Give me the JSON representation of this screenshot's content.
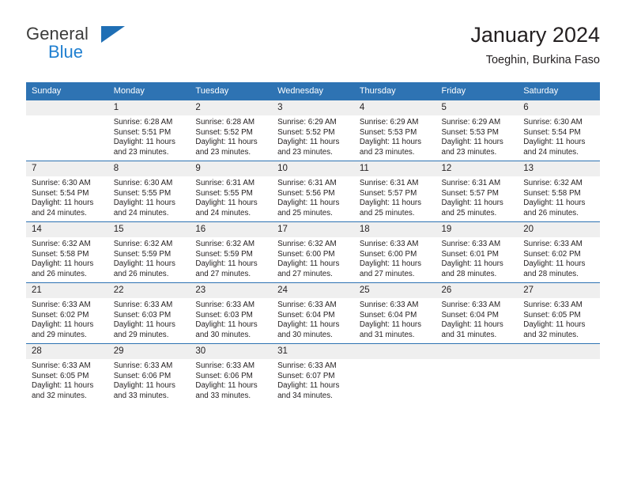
{
  "brand": {
    "name_top": "General",
    "name_bottom": "Blue",
    "triangle_color": "#1f6fb5",
    "blue_color": "#1f7fd0"
  },
  "header": {
    "title": "January 2024",
    "subtitle": "Toeghin, Burkina Faso"
  },
  "theme": {
    "header_blue": "#2e73b3",
    "daynum_gray": "#efefef",
    "text": "#231f20"
  },
  "calendar": {
    "weekday_headers": [
      "Sunday",
      "Monday",
      "Tuesday",
      "Wednesday",
      "Thursday",
      "Friday",
      "Saturday"
    ],
    "weeks": [
      [
        {
          "day": "",
          "sunrise": "",
          "sunset": "",
          "daylight_line1": "",
          "daylight_line2": ""
        },
        {
          "day": "1",
          "sunrise": "Sunrise: 6:28 AM",
          "sunset": "Sunset: 5:51 PM",
          "daylight_line1": "Daylight: 11 hours",
          "daylight_line2": "and 23 minutes."
        },
        {
          "day": "2",
          "sunrise": "Sunrise: 6:28 AM",
          "sunset": "Sunset: 5:52 PM",
          "daylight_line1": "Daylight: 11 hours",
          "daylight_line2": "and 23 minutes."
        },
        {
          "day": "3",
          "sunrise": "Sunrise: 6:29 AM",
          "sunset": "Sunset: 5:52 PM",
          "daylight_line1": "Daylight: 11 hours",
          "daylight_line2": "and 23 minutes."
        },
        {
          "day": "4",
          "sunrise": "Sunrise: 6:29 AM",
          "sunset": "Sunset: 5:53 PM",
          "daylight_line1": "Daylight: 11 hours",
          "daylight_line2": "and 23 minutes."
        },
        {
          "day": "5",
          "sunrise": "Sunrise: 6:29 AM",
          "sunset": "Sunset: 5:53 PM",
          "daylight_line1": "Daylight: 11 hours",
          "daylight_line2": "and 23 minutes."
        },
        {
          "day": "6",
          "sunrise": "Sunrise: 6:30 AM",
          "sunset": "Sunset: 5:54 PM",
          "daylight_line1": "Daylight: 11 hours",
          "daylight_line2": "and 24 minutes."
        }
      ],
      [
        {
          "day": "7",
          "sunrise": "Sunrise: 6:30 AM",
          "sunset": "Sunset: 5:54 PM",
          "daylight_line1": "Daylight: 11 hours",
          "daylight_line2": "and 24 minutes."
        },
        {
          "day": "8",
          "sunrise": "Sunrise: 6:30 AM",
          "sunset": "Sunset: 5:55 PM",
          "daylight_line1": "Daylight: 11 hours",
          "daylight_line2": "and 24 minutes."
        },
        {
          "day": "9",
          "sunrise": "Sunrise: 6:31 AM",
          "sunset": "Sunset: 5:55 PM",
          "daylight_line1": "Daylight: 11 hours",
          "daylight_line2": "and 24 minutes."
        },
        {
          "day": "10",
          "sunrise": "Sunrise: 6:31 AM",
          "sunset": "Sunset: 5:56 PM",
          "daylight_line1": "Daylight: 11 hours",
          "daylight_line2": "and 25 minutes."
        },
        {
          "day": "11",
          "sunrise": "Sunrise: 6:31 AM",
          "sunset": "Sunset: 5:57 PM",
          "daylight_line1": "Daylight: 11 hours",
          "daylight_line2": "and 25 minutes."
        },
        {
          "day": "12",
          "sunrise": "Sunrise: 6:31 AM",
          "sunset": "Sunset: 5:57 PM",
          "daylight_line1": "Daylight: 11 hours",
          "daylight_line2": "and 25 minutes."
        },
        {
          "day": "13",
          "sunrise": "Sunrise: 6:32 AM",
          "sunset": "Sunset: 5:58 PM",
          "daylight_line1": "Daylight: 11 hours",
          "daylight_line2": "and 26 minutes."
        }
      ],
      [
        {
          "day": "14",
          "sunrise": "Sunrise: 6:32 AM",
          "sunset": "Sunset: 5:58 PM",
          "daylight_line1": "Daylight: 11 hours",
          "daylight_line2": "and 26 minutes."
        },
        {
          "day": "15",
          "sunrise": "Sunrise: 6:32 AM",
          "sunset": "Sunset: 5:59 PM",
          "daylight_line1": "Daylight: 11 hours",
          "daylight_line2": "and 26 minutes."
        },
        {
          "day": "16",
          "sunrise": "Sunrise: 6:32 AM",
          "sunset": "Sunset: 5:59 PM",
          "daylight_line1": "Daylight: 11 hours",
          "daylight_line2": "and 27 minutes."
        },
        {
          "day": "17",
          "sunrise": "Sunrise: 6:32 AM",
          "sunset": "Sunset: 6:00 PM",
          "daylight_line1": "Daylight: 11 hours",
          "daylight_line2": "and 27 minutes."
        },
        {
          "day": "18",
          "sunrise": "Sunrise: 6:33 AM",
          "sunset": "Sunset: 6:00 PM",
          "daylight_line1": "Daylight: 11 hours",
          "daylight_line2": "and 27 minutes."
        },
        {
          "day": "19",
          "sunrise": "Sunrise: 6:33 AM",
          "sunset": "Sunset: 6:01 PM",
          "daylight_line1": "Daylight: 11 hours",
          "daylight_line2": "and 28 minutes."
        },
        {
          "day": "20",
          "sunrise": "Sunrise: 6:33 AM",
          "sunset": "Sunset: 6:02 PM",
          "daylight_line1": "Daylight: 11 hours",
          "daylight_line2": "and 28 minutes."
        }
      ],
      [
        {
          "day": "21",
          "sunrise": "Sunrise: 6:33 AM",
          "sunset": "Sunset: 6:02 PM",
          "daylight_line1": "Daylight: 11 hours",
          "daylight_line2": "and 29 minutes."
        },
        {
          "day": "22",
          "sunrise": "Sunrise: 6:33 AM",
          "sunset": "Sunset: 6:03 PM",
          "daylight_line1": "Daylight: 11 hours",
          "daylight_line2": "and 29 minutes."
        },
        {
          "day": "23",
          "sunrise": "Sunrise: 6:33 AM",
          "sunset": "Sunset: 6:03 PM",
          "daylight_line1": "Daylight: 11 hours",
          "daylight_line2": "and 30 minutes."
        },
        {
          "day": "24",
          "sunrise": "Sunrise: 6:33 AM",
          "sunset": "Sunset: 6:04 PM",
          "daylight_line1": "Daylight: 11 hours",
          "daylight_line2": "and 30 minutes."
        },
        {
          "day": "25",
          "sunrise": "Sunrise: 6:33 AM",
          "sunset": "Sunset: 6:04 PM",
          "daylight_line1": "Daylight: 11 hours",
          "daylight_line2": "and 31 minutes."
        },
        {
          "day": "26",
          "sunrise": "Sunrise: 6:33 AM",
          "sunset": "Sunset: 6:04 PM",
          "daylight_line1": "Daylight: 11 hours",
          "daylight_line2": "and 31 minutes."
        },
        {
          "day": "27",
          "sunrise": "Sunrise: 6:33 AM",
          "sunset": "Sunset: 6:05 PM",
          "daylight_line1": "Daylight: 11 hours",
          "daylight_line2": "and 32 minutes."
        }
      ],
      [
        {
          "day": "28",
          "sunrise": "Sunrise: 6:33 AM",
          "sunset": "Sunset: 6:05 PM",
          "daylight_line1": "Daylight: 11 hours",
          "daylight_line2": "and 32 minutes."
        },
        {
          "day": "29",
          "sunrise": "Sunrise: 6:33 AM",
          "sunset": "Sunset: 6:06 PM",
          "daylight_line1": "Daylight: 11 hours",
          "daylight_line2": "and 33 minutes."
        },
        {
          "day": "30",
          "sunrise": "Sunrise: 6:33 AM",
          "sunset": "Sunset: 6:06 PM",
          "daylight_line1": "Daylight: 11 hours",
          "daylight_line2": "and 33 minutes."
        },
        {
          "day": "31",
          "sunrise": "Sunrise: 6:33 AM",
          "sunset": "Sunset: 6:07 PM",
          "daylight_line1": "Daylight: 11 hours",
          "daylight_line2": "and 34 minutes."
        },
        {
          "day": "",
          "sunrise": "",
          "sunset": "",
          "daylight_line1": "",
          "daylight_line2": ""
        },
        {
          "day": "",
          "sunrise": "",
          "sunset": "",
          "daylight_line1": "",
          "daylight_line2": ""
        },
        {
          "day": "",
          "sunrise": "",
          "sunset": "",
          "daylight_line1": "",
          "daylight_line2": ""
        }
      ]
    ]
  }
}
